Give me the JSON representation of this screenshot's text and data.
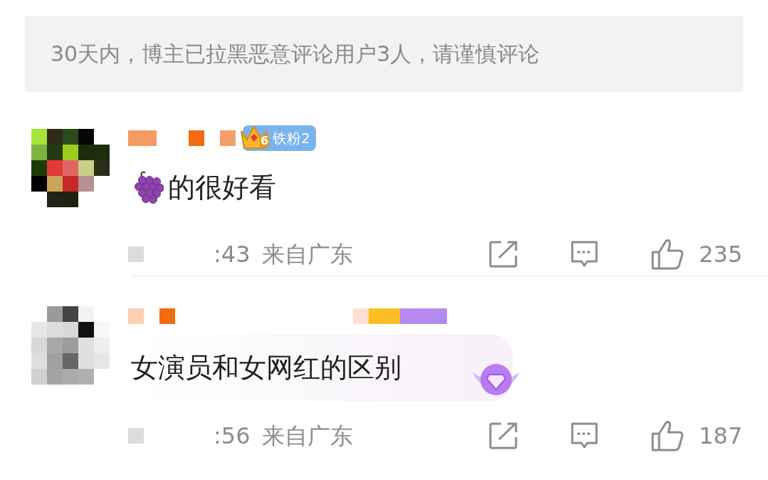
{
  "notice": "30天内，博主已拉黑恶意评论用户3人，请谨慎评论",
  "comments": [
    {
      "badge": {
        "level": "6",
        "label": "铁粉2"
      },
      "emoji_prefix": true,
      "text": "的很好看",
      "highlight_bubble": false,
      "time": ":43",
      "location": "来自广东",
      "likes": "235"
    },
    {
      "emoji_prefix": false,
      "text": "女演员和女网红的区别",
      "highlight_bubble": true,
      "time": ":56",
      "location": "来自广东",
      "likes": "187"
    }
  ]
}
